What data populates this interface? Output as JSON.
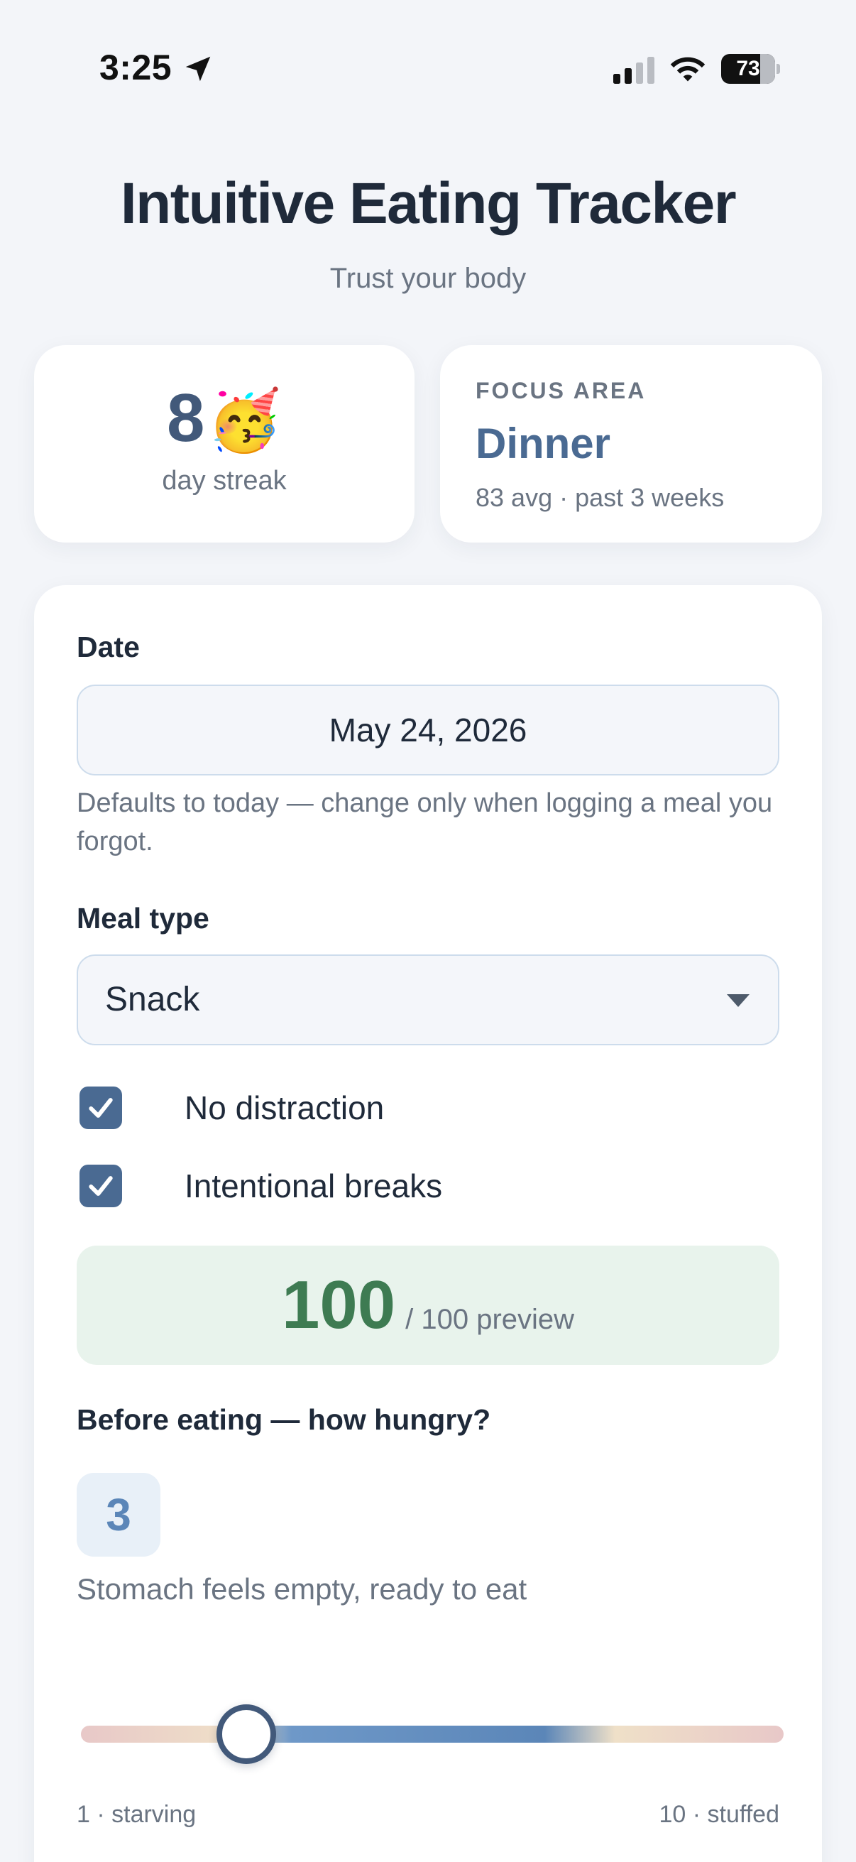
{
  "status_bar": {
    "time": "3:25",
    "battery": "73",
    "battery_level": 0.73,
    "icons": [
      "location-arrow-icon",
      "cellular-signal-icon",
      "wifi-icon",
      "battery-icon"
    ]
  },
  "header": {
    "title": "Intuitive Eating Tracker",
    "subtitle": "Trust your body"
  },
  "streak": {
    "count": "8",
    "emoji": "🥳",
    "label": "day streak"
  },
  "focus": {
    "label": "FOCUS AREA",
    "value": "Dinner",
    "sub": "83 avg · past 3 weeks"
  },
  "form": {
    "date_label": "Date",
    "date_value": "May 24, 2026",
    "date_help": "Defaults to today — change only when logging a meal you forgot.",
    "meal_label": "Meal type",
    "meal_value": "Snack",
    "checkboxes": [
      {
        "label": "No distraction",
        "checked": true
      },
      {
        "label": "Intentional breaks",
        "checked": true
      }
    ],
    "score": {
      "value": "100",
      "suffix": "/ 100 preview"
    },
    "hunger_label": "Before eating — how hungry?",
    "hunger_value": "3",
    "hunger_desc": "Stomach feels empty, ready to eat",
    "slider": {
      "min": 1,
      "max": 10,
      "value": 3,
      "min_label": "1 · starving",
      "max_label": "10 · stuffed"
    }
  },
  "colors": {
    "accent": "#4a6a92",
    "score_green": "#3e7b52",
    "background": "#f3f5f9"
  }
}
